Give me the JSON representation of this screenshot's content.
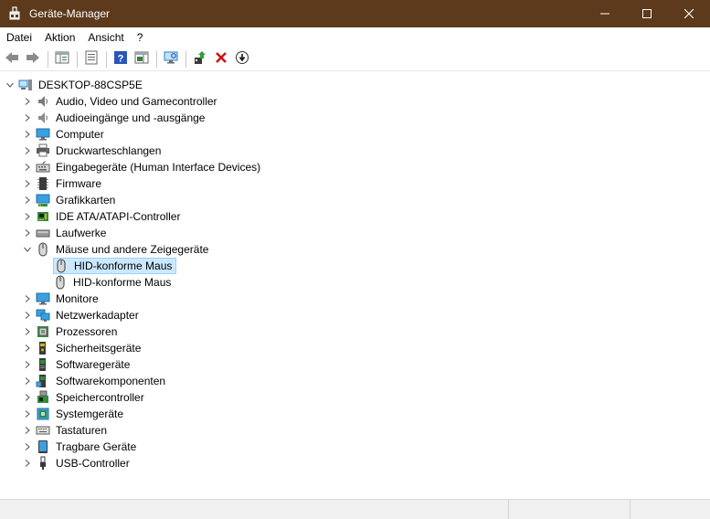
{
  "window": {
    "title": "Geräte-Manager",
    "titlebar_color": "#5c3a1b",
    "controls": [
      "minimize-icon",
      "maximize-icon",
      "close-icon"
    ]
  },
  "menu": [
    "Datei",
    "Aktion",
    "Ansicht",
    "?"
  ],
  "toolbar": {
    "buttons": [
      "back-arrow-icon",
      "forward-arrow-icon",
      "show-hide-console-tree-icon",
      "properties-icon",
      "help-icon",
      "action-pane-icon",
      "scan-hardware-icon",
      "update-driver-icon",
      "uninstall-device-icon",
      "disable-device-icon"
    ]
  },
  "tree": {
    "root": "DESKTOP-88CSP5E",
    "categories": [
      {
        "label": "Audio, Video und Gamecontroller",
        "icon": "audio-video-icon"
      },
      {
        "label": "Audioeingänge und -ausgänge",
        "icon": "speaker-icon"
      },
      {
        "label": "Computer",
        "icon": "computer-icon"
      },
      {
        "label": "Druckwarteschlangen",
        "icon": "printer-icon"
      },
      {
        "label": "Eingabegeräte (Human Interface Devices)",
        "icon": "hid-icon"
      },
      {
        "label": "Firmware",
        "icon": "firmware-icon"
      },
      {
        "label": "Grafikkarten",
        "icon": "display-adapter-icon"
      },
      {
        "label": "IDE ATA/ATAPI-Controller",
        "icon": "ide-controller-icon"
      },
      {
        "label": "Laufwerke",
        "icon": "disk-drive-icon"
      },
      {
        "label": "Mäuse und andere Zeigegeräte",
        "icon": "mouse-icon",
        "expanded": true,
        "children": [
          {
            "label": "HID-konforme Maus",
            "icon": "mouse-icon",
            "selected": true
          },
          {
            "label": "HID-konforme Maus",
            "icon": "mouse-icon"
          }
        ]
      },
      {
        "label": "Monitore",
        "icon": "monitor-icon"
      },
      {
        "label": "Netzwerkadapter",
        "icon": "network-adapter-icon"
      },
      {
        "label": "Prozessoren",
        "icon": "processor-icon"
      },
      {
        "label": "Sicherheitsgeräte",
        "icon": "security-device-icon"
      },
      {
        "label": "Softwaregeräte",
        "icon": "software-device-icon"
      },
      {
        "label": "Softwarekomponenten",
        "icon": "software-component-icon"
      },
      {
        "label": "Speichercontroller",
        "icon": "storage-controller-icon"
      },
      {
        "label": "Systemgeräte",
        "icon": "system-device-icon"
      },
      {
        "label": "Tastaturen",
        "icon": "keyboard-icon"
      },
      {
        "label": "Tragbare Geräte",
        "icon": "portable-device-icon"
      },
      {
        "label": "USB-Controller",
        "icon": "usb-icon"
      }
    ]
  },
  "colors": {
    "selection_bg": "#cce8ff",
    "selection_border": "#99d1ff",
    "uninstall_red": "#d01010"
  }
}
